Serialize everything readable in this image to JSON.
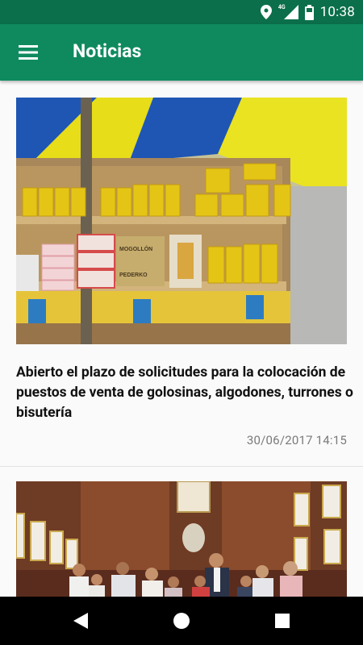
{
  "status_bar": {
    "time": "10:38",
    "network": "4G",
    "icons": [
      "location-icon",
      "signal-icon",
      "battery-icon"
    ]
  },
  "app_bar": {
    "title": "Noticias",
    "menu_icon": "hamburger-menu-icon"
  },
  "news": [
    {
      "title": "Abierto el plazo de solicitudes para la colocación de puestos de venta de golosinas, algodones, turrones o bisutería",
      "date": "30/06/2017 14:15",
      "image": "sweets-stall-photo",
      "image_texts": [
        "MOGOLLÓN",
        "PEDERKO"
      ]
    },
    {
      "image": "group-photo-town-hall"
    }
  ],
  "nav_bar": {
    "icons": [
      "back-icon",
      "home-icon",
      "recents-icon"
    ]
  },
  "colors": {
    "status_bar": "#0b6f4b",
    "app_bar": "#0f8a5f",
    "card_background": "#fafafa",
    "date_text": "#7a7a7a"
  }
}
